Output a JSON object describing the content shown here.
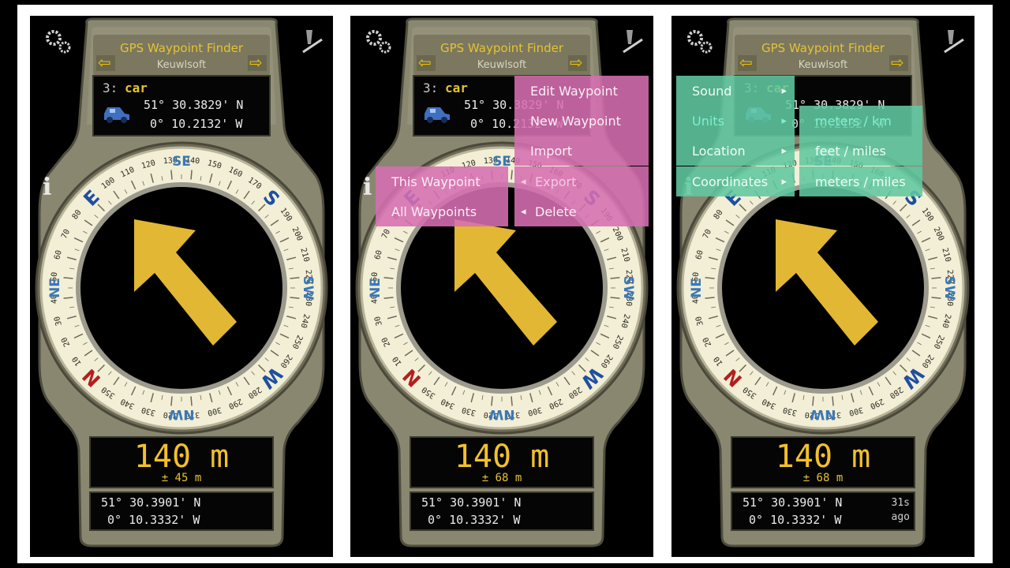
{
  "app": {
    "title": "GPS Waypoint Finder",
    "subtitle": "Keuwlsoft"
  },
  "icons": {
    "settings": "gear-icon",
    "edit": "pen-marker-icon",
    "info": "info-icon",
    "prev": "arrow-left-icon",
    "next": "arrow-right-icon",
    "car": "car-icon",
    "info_glyph": "i",
    "prev_glyph": "⇦",
    "next_glyph": "⇨",
    "submenu_right": "▸",
    "submenu_left": "◂"
  },
  "waypoint": {
    "number": "3:",
    "name": "car",
    "lat": "51° 30.3829' N",
    "lon": "0° 10.2132' W"
  },
  "compass": {
    "heading_labels": [
      "N",
      "NE",
      "E",
      "SE",
      "S",
      "SW",
      "W",
      "NW"
    ]
  },
  "screens": [
    {
      "distance": "140 m",
      "accuracy": "± 45 m",
      "pos_lat": "51° 30.3901' N",
      "pos_lon": "0° 10.3332' W",
      "ago_1": "",
      "ago_2": ""
    },
    {
      "distance": "140 m",
      "accuracy": "± 68 m",
      "pos_lat": "51° 30.3901' N",
      "pos_lon": "0° 10.3332' W",
      "ago_1": "",
      "ago_2": ""
    },
    {
      "distance": "140 m",
      "accuracy": "± 68 m",
      "pos_lat": "51° 30.3901' N",
      "pos_lon": "0° 10.3332' W",
      "ago_1": "31s",
      "ago_2": "ago"
    }
  ],
  "waypoint_menu": {
    "items": [
      "Edit Waypoint",
      "New Waypoint",
      "Import",
      "Export",
      "Delete"
    ],
    "export_sub": [
      "This Waypoint",
      "All Waypoints"
    ]
  },
  "settings_menu": {
    "items": [
      "Sound",
      "Units",
      "Location",
      "Coordinates"
    ],
    "units_sub": [
      "meters / km",
      "feet / miles",
      "meters / miles"
    ]
  },
  "colors": {
    "accent_yellow": "#f2c02b",
    "menu_pink": "#d66eb2",
    "menu_green": "#60c8a0",
    "device_body": "#8a8770"
  }
}
